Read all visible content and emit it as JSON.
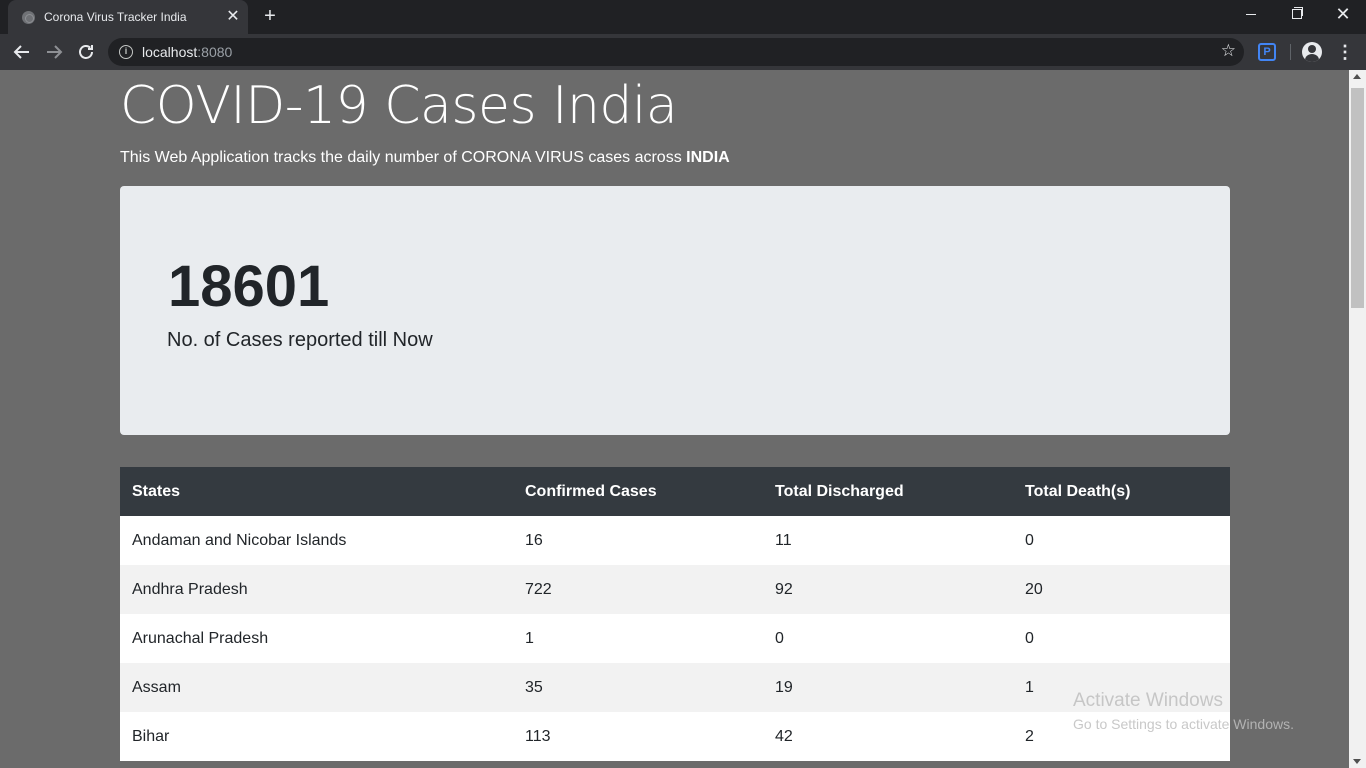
{
  "browser": {
    "tab_title": "Corona Virus Tracker India",
    "tab_close": "✕",
    "new_tab": "+",
    "url_host": "localhost",
    "url_port": ":8080",
    "close_glyph": "✕"
  },
  "page": {
    "title": "COVID-19 Cases India",
    "subtitle_text": "This Web Application tracks the daily number of CORONA VIRUS cases across ",
    "subtitle_bold": "INDIA"
  },
  "summary": {
    "total_cases": "18601",
    "label": "No. of Cases reported till Now"
  },
  "table": {
    "headers": [
      "States",
      "Confirmed Cases",
      "Total Discharged",
      "Total Death(s)"
    ],
    "rows": [
      [
        "Andaman and Nicobar Islands",
        "16",
        "11",
        "0"
      ],
      [
        "Andhra Pradesh",
        "722",
        "92",
        "20"
      ],
      [
        "Arunachal Pradesh",
        "1",
        "0",
        "0"
      ],
      [
        "Assam",
        "35",
        "19",
        "1"
      ],
      [
        "Bihar",
        "113",
        "42",
        "2"
      ]
    ]
  },
  "watermark": {
    "title": "Activate Windows",
    "subtitle": "Go to Settings to activate Windows."
  }
}
